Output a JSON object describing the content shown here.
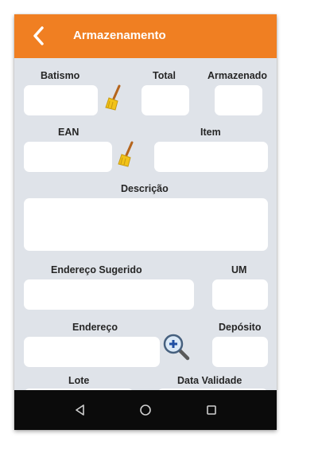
{
  "appbar": {
    "title": "Armazenamento",
    "back_icon": "back-arrow-icon"
  },
  "form": {
    "batismo_label": "Batismo",
    "total_label": "Total",
    "armazenado_label": "Armazenado",
    "ean_label": "EAN",
    "item_label": "Item",
    "descricao_label": "Descrição",
    "endereco_sugerido_label": "Endereço Sugerido",
    "um_label": "UM",
    "endereco_label": "Endereço",
    "deposito_label": "Depósito",
    "lote_label": "Lote",
    "data_validade_label": "Data Validade"
  },
  "icons": {
    "clear_batismo": "broom-icon",
    "clear_ean": "broom-icon",
    "search_endereco": "zoom-in-icon"
  },
  "navbar": {
    "icons": [
      "back-triangle-icon",
      "home-circle-icon",
      "recents-square-icon"
    ]
  },
  "colors": {
    "accent": "#f07f22",
    "background": "#dfe3e9",
    "navbar": "#0b0b0b"
  }
}
